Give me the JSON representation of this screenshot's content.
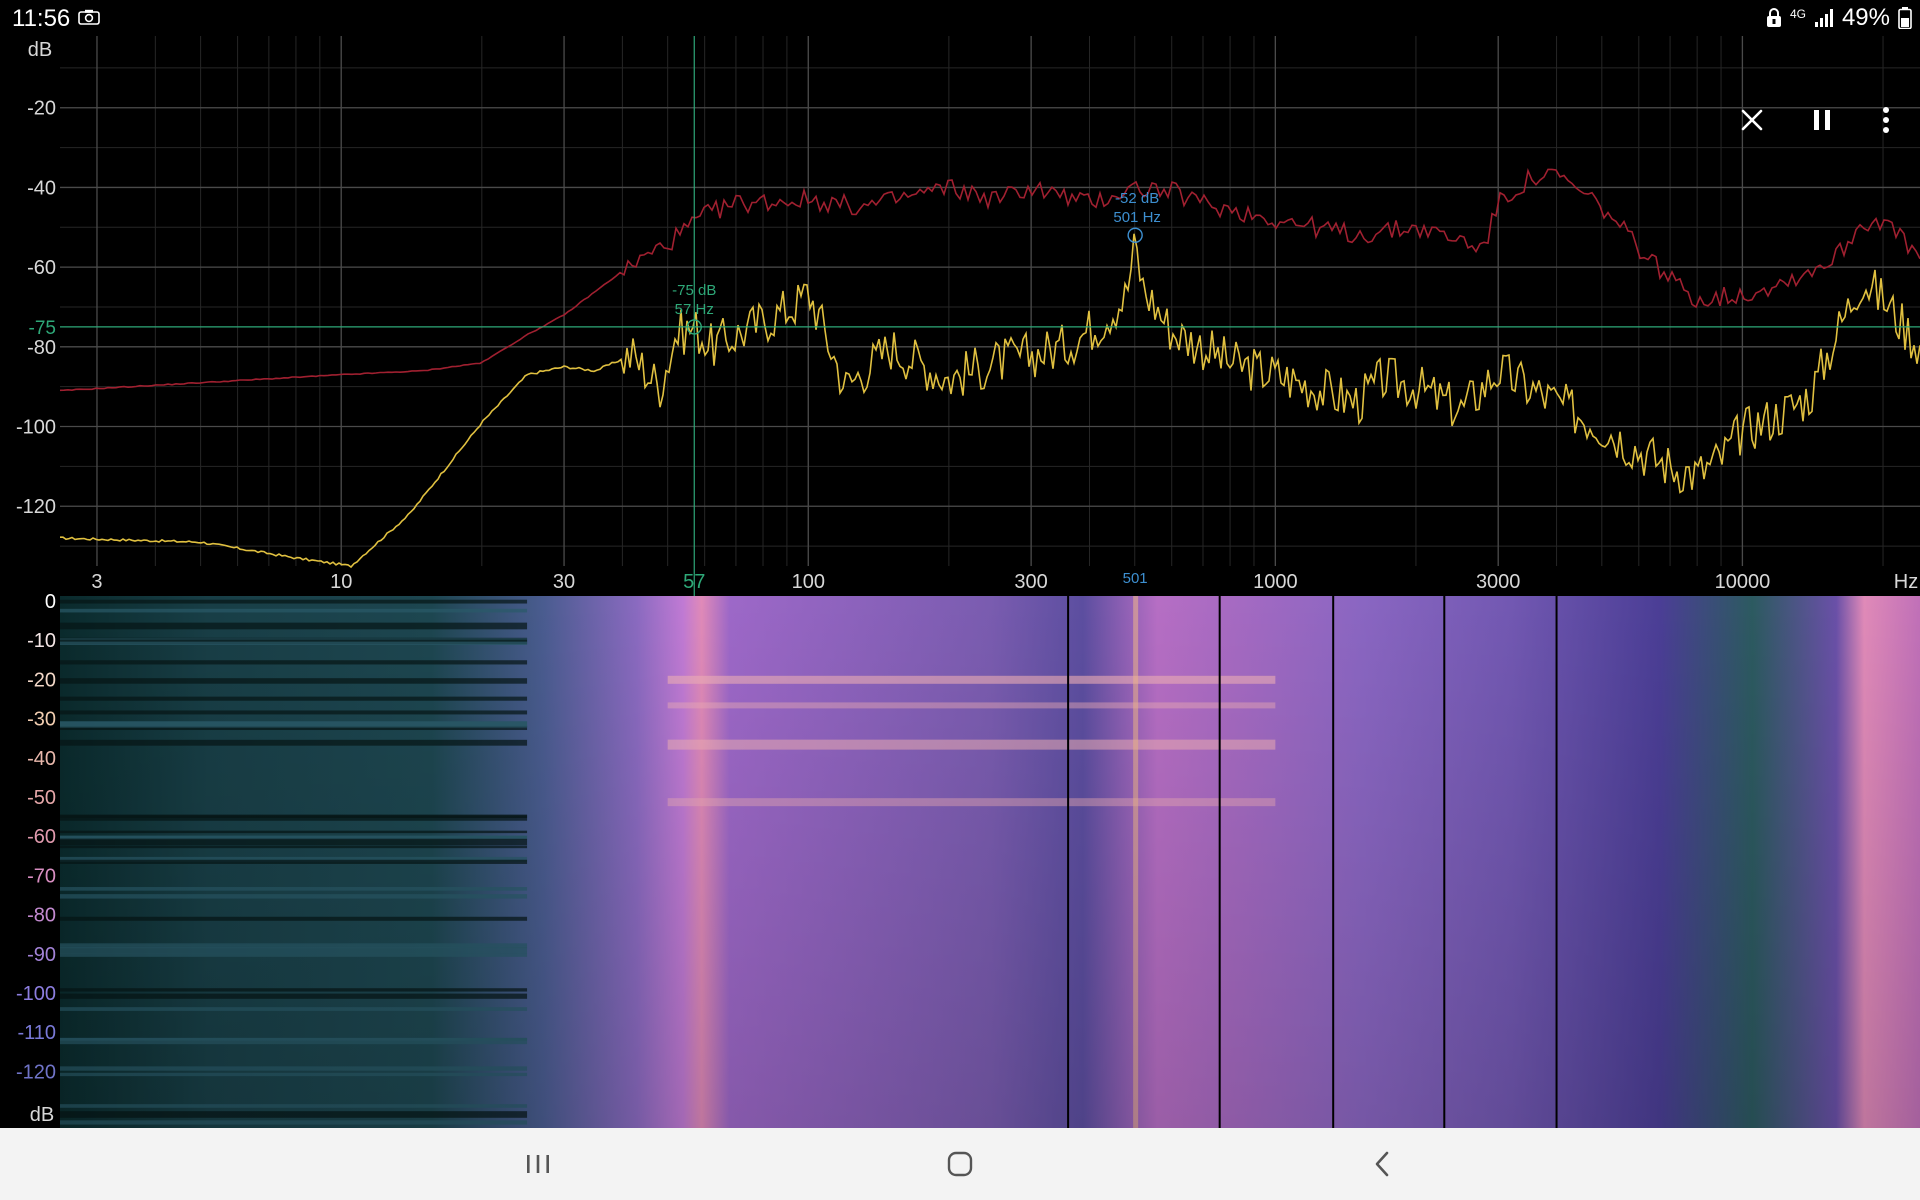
{
  "status_bar": {
    "time": "11:56",
    "network": "4G",
    "battery": "49%",
    "icons": [
      "camera-icon",
      "lock-icon",
      "signal-icon",
      "battery-icon"
    ]
  },
  "toolbar": {
    "close_icon": "close-icon",
    "pause_icon": "pause-icon",
    "more_icon": "more-vert-icon"
  },
  "spectrum": {
    "y_unit": "dB",
    "x_unit": "Hz",
    "y_ticks": [
      "-20",
      "-40",
      "-60",
      "-80",
      "-100",
      "-120"
    ],
    "y_tick_values": [
      -20,
      -40,
      -60,
      -80,
      -100,
      -120
    ],
    "y_range": [
      -135,
      -2
    ],
    "x_ticks": [
      "3",
      "10",
      "30",
      "100",
      "300",
      "1000",
      "3000",
      "10000"
    ],
    "x_tick_values": [
      3,
      10,
      30,
      100,
      300,
      1000,
      3000,
      10000
    ],
    "x_range": [
      2.5,
      24000
    ],
    "cursor": {
      "freq": 57,
      "db": -75,
      "freq_label": "57",
      "db_label": "-75",
      "readout_db": "-75 dB",
      "readout_hz": "57 Hz",
      "color": "#2ea878"
    },
    "peak": {
      "freq": 501,
      "db": -52,
      "freq_label": "501",
      "readout_db": "-52 dB",
      "readout_hz": "501 Hz",
      "color": "#3d8fd0"
    },
    "colors": {
      "current": "#e0c040",
      "peak_hold": "#a02030",
      "grid": "#3a3a3a"
    }
  },
  "spectrogram": {
    "y_unit": "dB",
    "y_ticks": [
      "0",
      "-10",
      "-20",
      "-30",
      "-40",
      "-50",
      "-60",
      "-70",
      "-80",
      "-90",
      "-100",
      "-110",
      "-120"
    ],
    "y_tick_colors": [
      "#ffffff",
      "#f4e6e6",
      "#f2d7c7",
      "#f1cdb0",
      "#e9b8ac",
      "#e6a7a9",
      "#e19aae",
      "#d98ec2",
      "#c38ad0",
      "#a383d8",
      "#8d7ee0",
      "#7a7ad8",
      "#7074c8"
    ]
  },
  "chart_data": {
    "type": "line",
    "title": "",
    "xlabel": "Hz",
    "ylabel": "dB",
    "xscale": "log",
    "xlim": [
      2.5,
      24000
    ],
    "ylim": [
      -135,
      -2
    ],
    "grid": true,
    "series": [
      {
        "color": "#e0c040",
        "x": [
          2.5,
          5,
          8,
          10.5,
          14,
          20,
          25,
          30,
          35,
          42,
          48,
          50,
          52,
          57,
          62,
          70,
          85,
          95,
          100,
          105,
          120,
          150,
          200,
          250,
          300,
          350,
          420,
          480,
          501,
          520,
          600,
          700,
          800,
          1000,
          1200,
          1500,
          1700,
          2000,
          2500,
          3000,
          4000,
          5000,
          6000,
          7000,
          8000,
          9000,
          10000,
          12000,
          14000,
          16000,
          18000,
          20000,
          24000
        ],
        "y": [
          -128,
          -129,
          -133,
          -135,
          -122,
          -99,
          -87,
          -85,
          -86,
          -82,
          -90,
          -84,
          -77,
          -75,
          -80,
          -77,
          -72,
          -69,
          -66,
          -72,
          -90,
          -80,
          -88,
          -84,
          -82,
          -80,
          -74,
          -67,
          -54,
          -65,
          -76,
          -80,
          -84,
          -87,
          -90,
          -94,
          -88,
          -90,
          -96,
          -86,
          -94,
          -100,
          -106,
          -110,
          -112,
          -108,
          -101,
          -97,
          -92,
          -76,
          -63,
          -68,
          -80
        ]
      },
      {
        "color": "#a02030",
        "x": [
          2.5,
          5,
          10,
          15,
          20,
          25,
          30,
          40,
          50,
          60,
          70,
          100,
          130,
          200,
          250,
          300,
          400,
          500,
          600,
          700,
          1000,
          1500,
          2000,
          2800,
          3000,
          3500,
          4000,
          5000,
          6000,
          7000,
          8000,
          10000,
          12000,
          14000,
          16000,
          18000,
          20000,
          24000
        ],
        "y": [
          -91,
          -89,
          -87,
          -86,
          -84,
          -77,
          -72,
          -61,
          -54,
          -47,
          -44,
          -43,
          -45,
          -40,
          -43,
          -40,
          -44,
          -40,
          -41,
          -44,
          -48,
          -52,
          -50,
          -55,
          -44,
          -38,
          -37,
          -45,
          -55,
          -63,
          -68,
          -67,
          -64,
          -61,
          -57,
          -49,
          -48,
          -58
        ]
      }
    ]
  }
}
